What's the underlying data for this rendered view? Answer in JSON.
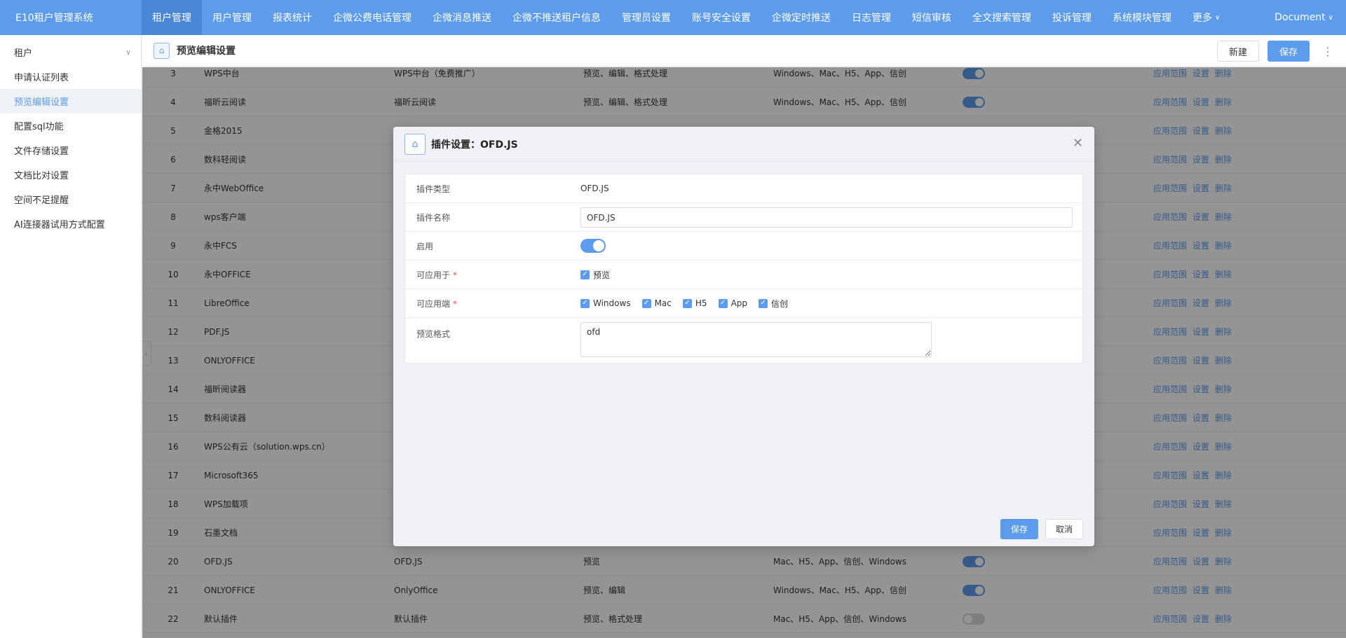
{
  "app": {
    "title": "E10租户管理系统"
  },
  "nav": {
    "items": [
      "租户管理",
      "用户管理",
      "报表统计",
      "企微公费电话管理",
      "企微消息推送",
      "企微不推送租户信息",
      "管理员设置",
      "账号安全设置",
      "企微定时推送",
      "日志管理",
      "短信审核",
      "全文搜索管理",
      "投诉管理",
      "系统模块管理",
      "更多"
    ],
    "active_index": 0,
    "user": "Document"
  },
  "sidebar": {
    "items": [
      "租户",
      "申请认证列表",
      "预览编辑设置",
      "配置sql功能",
      "文件存储设置",
      "文档比对设置",
      "空间不足提醒",
      "AI连接器试用方式配置"
    ],
    "active_index": 2
  },
  "header": {
    "title": "预览编辑设置",
    "new_label": "新建",
    "save_label": "保存"
  },
  "table": {
    "ops": [
      "应用范围",
      "设置",
      "删除"
    ],
    "rows": [
      {
        "num": "3",
        "name": "WPS中台",
        "type": "WPS中台（免费推广）",
        "apply": "预览、编辑、格式处理",
        "term": "Windows、Mac、H5、App、信创",
        "enabled": true
      },
      {
        "num": "4",
        "name": "福昕云阅读",
        "type": "福昕云阅读",
        "apply": "预览、编辑、格式处理",
        "term": "Windows、Mac、H5、App、信创",
        "enabled": true
      },
      {
        "num": "5",
        "name": "金格2015",
        "type": "",
        "apply": "",
        "term": "",
        "enabled": null
      },
      {
        "num": "6",
        "name": "数科轻阅读",
        "type": "",
        "apply": "",
        "term": "",
        "enabled": null
      },
      {
        "num": "7",
        "name": "永中WebOffice",
        "type": "",
        "apply": "",
        "term": "",
        "enabled": null
      },
      {
        "num": "8",
        "name": "wps客户端",
        "type": "",
        "apply": "",
        "term": "",
        "enabled": null
      },
      {
        "num": "9",
        "name": "永中FCS",
        "type": "",
        "apply": "",
        "term": "",
        "enabled": null
      },
      {
        "num": "10",
        "name": "永中OFFICE",
        "type": "",
        "apply": "",
        "term": "",
        "enabled": null
      },
      {
        "num": "11",
        "name": "LibreOffice",
        "type": "",
        "apply": "",
        "term": "",
        "enabled": null
      },
      {
        "num": "12",
        "name": "PDF.JS",
        "type": "",
        "apply": "",
        "term": "",
        "enabled": null
      },
      {
        "num": "13",
        "name": "ONLYOFFICE",
        "type": "",
        "apply": "",
        "term": "",
        "enabled": null
      },
      {
        "num": "14",
        "name": "福昕阅读器",
        "type": "",
        "apply": "",
        "term": "",
        "enabled": null
      },
      {
        "num": "15",
        "name": "数科阅读器",
        "type": "",
        "apply": "",
        "term": "",
        "enabled": null
      },
      {
        "num": "16",
        "name": "WPS公有云（solution.wps.cn）",
        "type": "",
        "apply": "",
        "term": "",
        "enabled": null
      },
      {
        "num": "17",
        "name": "Microsoft365",
        "type": "",
        "apply": "",
        "term": "",
        "enabled": null
      },
      {
        "num": "18",
        "name": "WPS加载项",
        "type": "",
        "apply": "",
        "term": "",
        "enabled": null
      },
      {
        "num": "19",
        "name": "石墨文档",
        "type": "",
        "apply": "",
        "term": "",
        "enabled": null
      },
      {
        "num": "20",
        "name": "OFD.JS",
        "type": "OFD.JS",
        "apply": "预览",
        "term": "Mac、H5、App、信创、Windows",
        "enabled": true
      },
      {
        "num": "21",
        "name": "ONLYOFFICE",
        "type": "OnlyOffice",
        "apply": "预览、编辑",
        "term": "Windows、Mac、H5、App、信创",
        "enabled": true
      },
      {
        "num": "22",
        "name": "默认插件",
        "type": "默认插件",
        "apply": "预览、格式处理",
        "term": "Mac、H5、App、信创、Windows",
        "enabled": false
      }
    ]
  },
  "modal": {
    "title": "插件设置：OFD.JS",
    "fields": {
      "type_label": "插件类型",
      "type_value": "OFD.JS",
      "name_label": "插件名称",
      "name_value": "OFD.JS",
      "enable_label": "启用",
      "apply_label": "可应用于",
      "apply_options": [
        "预览"
      ],
      "term_label": "可应用端",
      "term_options": [
        "Windows",
        "Mac",
        "H5",
        "App",
        "信创"
      ],
      "format_label": "预览格式",
      "format_value": "ofd"
    },
    "save_label": "保存",
    "cancel_label": "取消"
  },
  "colors": {
    "accent": "#5d9cec",
    "required": "#e5534b"
  }
}
